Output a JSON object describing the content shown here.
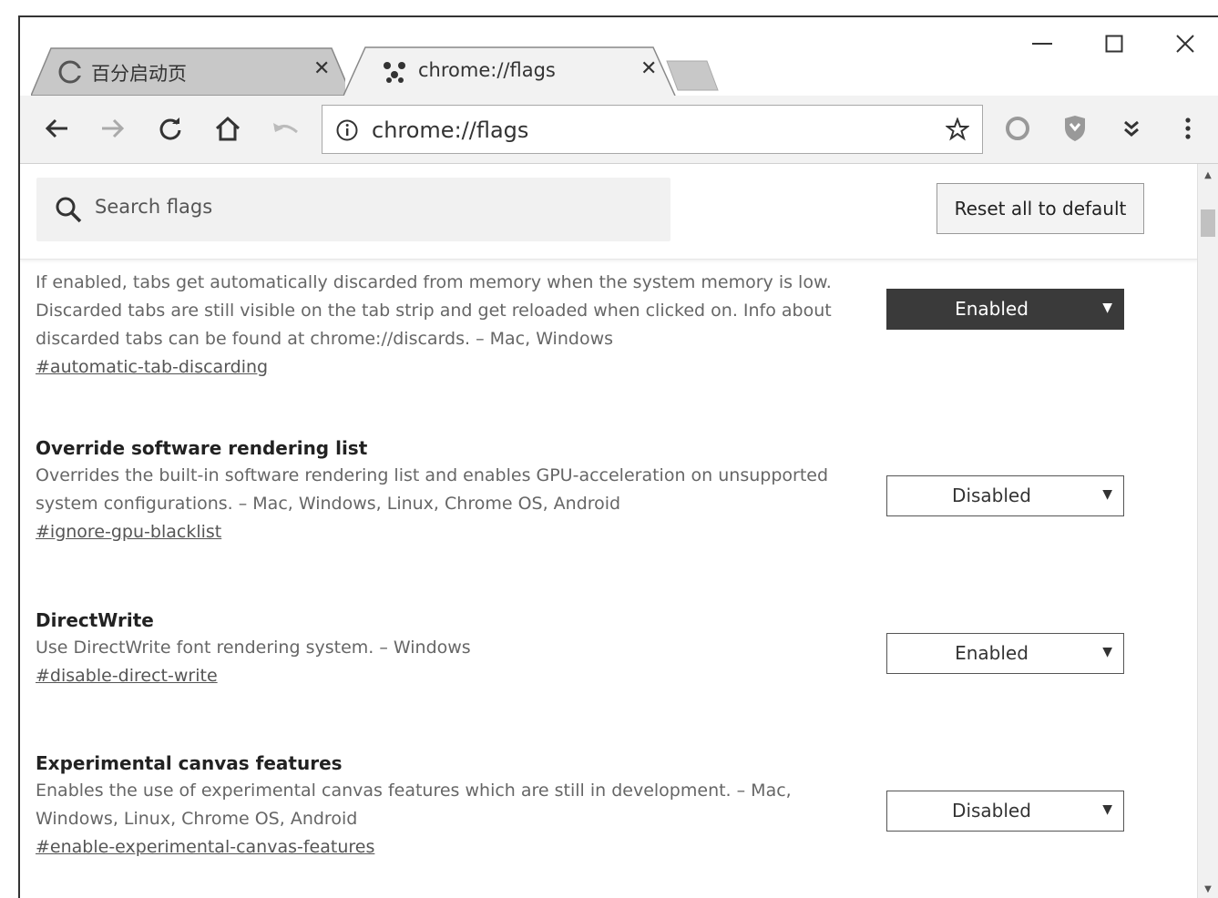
{
  "tabs": [
    {
      "label": "百分启动页",
      "active": false
    },
    {
      "label": "chrome://flags",
      "active": true
    }
  ],
  "omnibox": {
    "url": "chrome://flags"
  },
  "search": {
    "placeholder": "Search flags"
  },
  "reset_label": "Reset all to default",
  "flags": [
    {
      "title": "",
      "description": "If enabled, tabs get automatically discarded from memory when the system memory is low. Discarded tabs are still visible on the tab strip and get reloaded when clicked on. Info about discarded tabs can be found at chrome://discards. – Mac, Windows",
      "link": "#automatic-tab-discarding",
      "value": "Enabled"
    },
    {
      "title": "Override software rendering list",
      "description": "Overrides the built-in software rendering list and enables GPU-acceleration on unsupported system configurations. – Mac, Windows, Linux, Chrome OS, Android",
      "link": "#ignore-gpu-blacklist",
      "value": "Disabled"
    },
    {
      "title": "DirectWrite",
      "description": "Use DirectWrite font rendering system. – Windows",
      "link": "#disable-direct-write",
      "value": "Enabled"
    },
    {
      "title": "Experimental canvas features",
      "description": "Enables the use of experimental canvas features which are still in development. – Mac, Windows, Linux, Chrome OS, Android",
      "link": "#enable-experimental-canvas-features",
      "value": "Disabled"
    }
  ],
  "icons": {
    "back": "arrow-left-icon",
    "forward": "arrow-right-icon",
    "reload": "reload-icon",
    "home": "home-icon",
    "undo": "undo-icon",
    "info": "info-icon",
    "star": "star-icon",
    "search": "search-icon",
    "menu": "more-vertical-icon"
  },
  "colors": {
    "enabled_select_bg": "#3a3a3a",
    "toolbar_bg": "#f2f2f2",
    "tab_inactive": "#c8c8c8"
  }
}
